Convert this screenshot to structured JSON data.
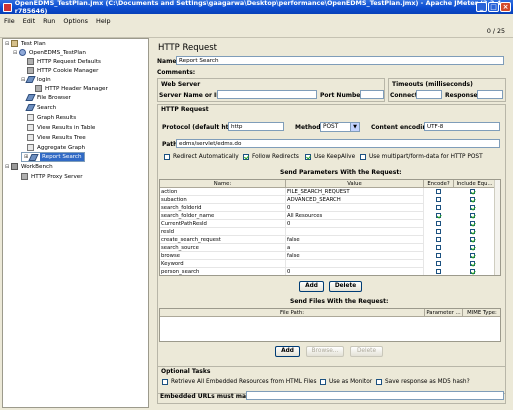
{
  "window": {
    "title": "OpenEDMS_TestPlan.jmx (C:\\Documents and Settings\\gaagarwa\\Desktop\\performance\\OpenEDMS_TestPlan.jmx) - Apache JMeter (2.3.4 r785646)"
  },
  "menu": {
    "file": "File",
    "edit": "Edit",
    "run": "Run",
    "options": "Options",
    "help": "Help"
  },
  "counter": "0 / 25",
  "tree": {
    "test_plan": "Test Plan",
    "openedms": "OpenEDMS_TestPlan",
    "http_defaults": "HTTP Request Defaults",
    "cookie_manager": "HTTP Cookie Manager",
    "login": "login",
    "header_manager": "HTTP Header Manager",
    "file_browser": "File Browser",
    "search": "Search",
    "graph_results": "Graph Results",
    "view_table": "View Results in Table",
    "view_tree": "View Results Tree",
    "aggregate_graph": "Aggregate Graph",
    "report_search": "Report Search",
    "workbench": "WorkBench",
    "proxy_server": "HTTP Proxy Server"
  },
  "form": {
    "heading": "HTTP Request",
    "name_label": "Name:",
    "name_value": "Report Search",
    "comments_label": "Comments:",
    "web_server": "Web Server",
    "server_label": "Server Name or IP:",
    "port_label": "Port Number:",
    "timeouts": "Timeouts (milliseconds)",
    "connect_label": "Connect:",
    "response_label": "Response:",
    "http_request": "HTTP Request",
    "protocol_label": "Protocol (default http):",
    "protocol_value": "http",
    "method_label": "Method:",
    "method_value": "POST",
    "encoding_label": "Content encoding:",
    "encoding_value": "UTF-8",
    "path_label": "Path:",
    "path_value": "edms/servlet/edms.do",
    "redirect_auto": "Redirect Automatically",
    "follow_redirects": "Follow Redirects",
    "keepalive": "Use KeepAlive",
    "multipart": "Use multipart/form-data for HTTP POST",
    "params_title": "Send Parameters With the Request:",
    "col_name": "Name:",
    "col_value": "Value",
    "col_encode": "Encode?",
    "col_include": "Include Equ...",
    "add": "Add",
    "delete": "Delete",
    "files_title": "Send Files With the Request:",
    "col_filepath": "File Path:",
    "col_param": "Parameter ...",
    "col_mime": "MIME Type:",
    "browse": "Browse...",
    "optional_tasks": "Optional Tasks",
    "retrieve_embedded": "Retrieve All Embedded Resources from HTML Files",
    "use_monitor": "Use as Monitor",
    "save_md5": "Save response as MD5 hash?",
    "embedded_urls": "Embedded URLs must match:"
  },
  "params": [
    {
      "name": "action",
      "value": "FILE_SEARCH_REQUEST",
      "encode": false,
      "include": true
    },
    {
      "name": "subaction",
      "value": "ADVANCED_SEARCH",
      "encode": false,
      "include": true
    },
    {
      "name": "search_folderid",
      "value": "0",
      "encode": false,
      "include": true
    },
    {
      "name": "search_folder_name",
      "value": "All Resources",
      "encode": true,
      "include": true
    },
    {
      "name": "CurrentPathResId",
      "value": "0",
      "encode": false,
      "include": true
    },
    {
      "name": "resId",
      "value": "",
      "encode": false,
      "include": true
    },
    {
      "name": "create_search_request",
      "value": "false",
      "encode": false,
      "include": true
    },
    {
      "name": "search_source",
      "value": "a",
      "encode": false,
      "include": true
    },
    {
      "name": "browse",
      "value": "false",
      "encode": false,
      "include": true
    },
    {
      "name": "Keyword",
      "value": "",
      "encode": false,
      "include": true
    },
    {
      "name": "person_search",
      "value": "0",
      "encode": false,
      "include": true
    }
  ],
  "colors": {
    "titlebar": "#0b4cd0",
    "selection": "#316ac5",
    "background": "#ece9d8"
  }
}
